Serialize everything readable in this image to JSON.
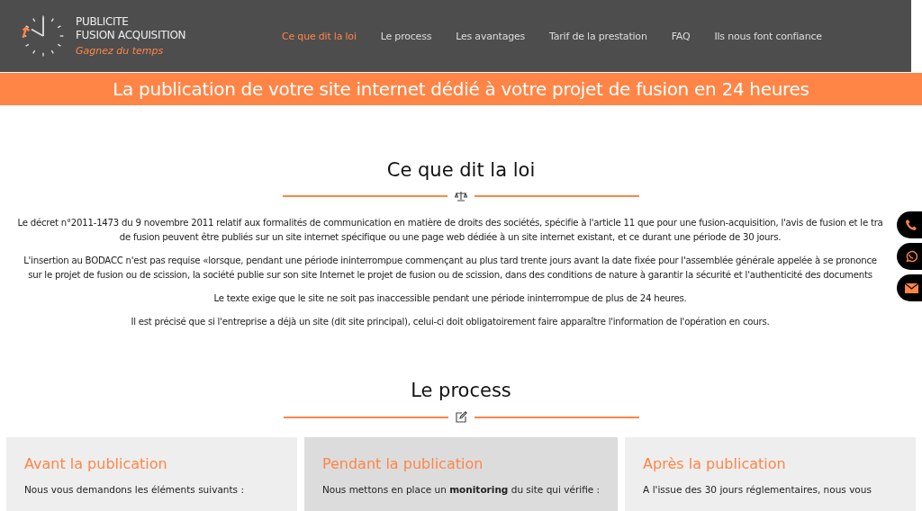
{
  "logo": {
    "line1": "PUBLICITE",
    "line2": "FUSION ACQUISITION",
    "tagline": "Gagnez du temps"
  },
  "nav": [
    {
      "label": "Ce que dit la loi",
      "selected": true
    },
    {
      "label": "Le process",
      "selected": false
    },
    {
      "label": "Les avantages",
      "selected": false
    },
    {
      "label": "Tarif de la prestation",
      "selected": false
    },
    {
      "label": "FAQ",
      "selected": false
    },
    {
      "label": "Ils nous font confiance",
      "selected": false
    }
  ],
  "banner": "La publication de votre site internet dédié à votre projet de fusion en 24 heures",
  "law": {
    "title": "Ce que dit la loi",
    "paragraphs": [
      [
        "Le décret n°2011-1473 du 9 novembre 2011 relatif aux formalités de communication en matière de droits des sociétés, spécifie à l'article 11 que pour une fusion-acquisition, l'avis de fusion et le tra",
        "de fusion peuvent être publiés sur un site internet spécifique ou une page web dédiée à un site internet existant, et ce durant une période de 30 jours."
      ],
      [
        "L'insertion au BODACC n'est pas requise «lorsque, pendant une période ininterrompue commençant au plus tard trente jours avant la date fixée pour l'assemblée générale appelée à se prononce",
        "sur le projet de fusion ou de scission, la société publie sur son site Internet le projet de fusion ou de scission, dans des conditions de nature à garantir la sécurité et l'authenticité des documents"
      ],
      [
        "Le texte exige que le site ne soit pas inaccessible pendant une période ininterrompue de plus de 24 heures."
      ],
      [
        "Il est précisé que si l'entreprise a déjà un site (dit site principal), celui-ci doit obligatoirement faire apparaître l'information de l'opération en cours."
      ]
    ]
  },
  "process": {
    "title": "Le process",
    "cards": [
      {
        "title": "Avant la publication",
        "text": "Nous vous demandons les éléments suivants :",
        "selected": false
      },
      {
        "title": "Pendant la publication",
        "text": "Nous mettons en place un **monitoring** du site qui vérifie :",
        "selected": true
      },
      {
        "title": "Après la publication",
        "text": "A l'issue des 30 jours réglementaires, nous vous",
        "selected": false
      }
    ]
  },
  "contact_buttons": [
    {
      "kind": "phone"
    },
    {
      "kind": "whatsapp"
    },
    {
      "kind": "mail"
    }
  ]
}
